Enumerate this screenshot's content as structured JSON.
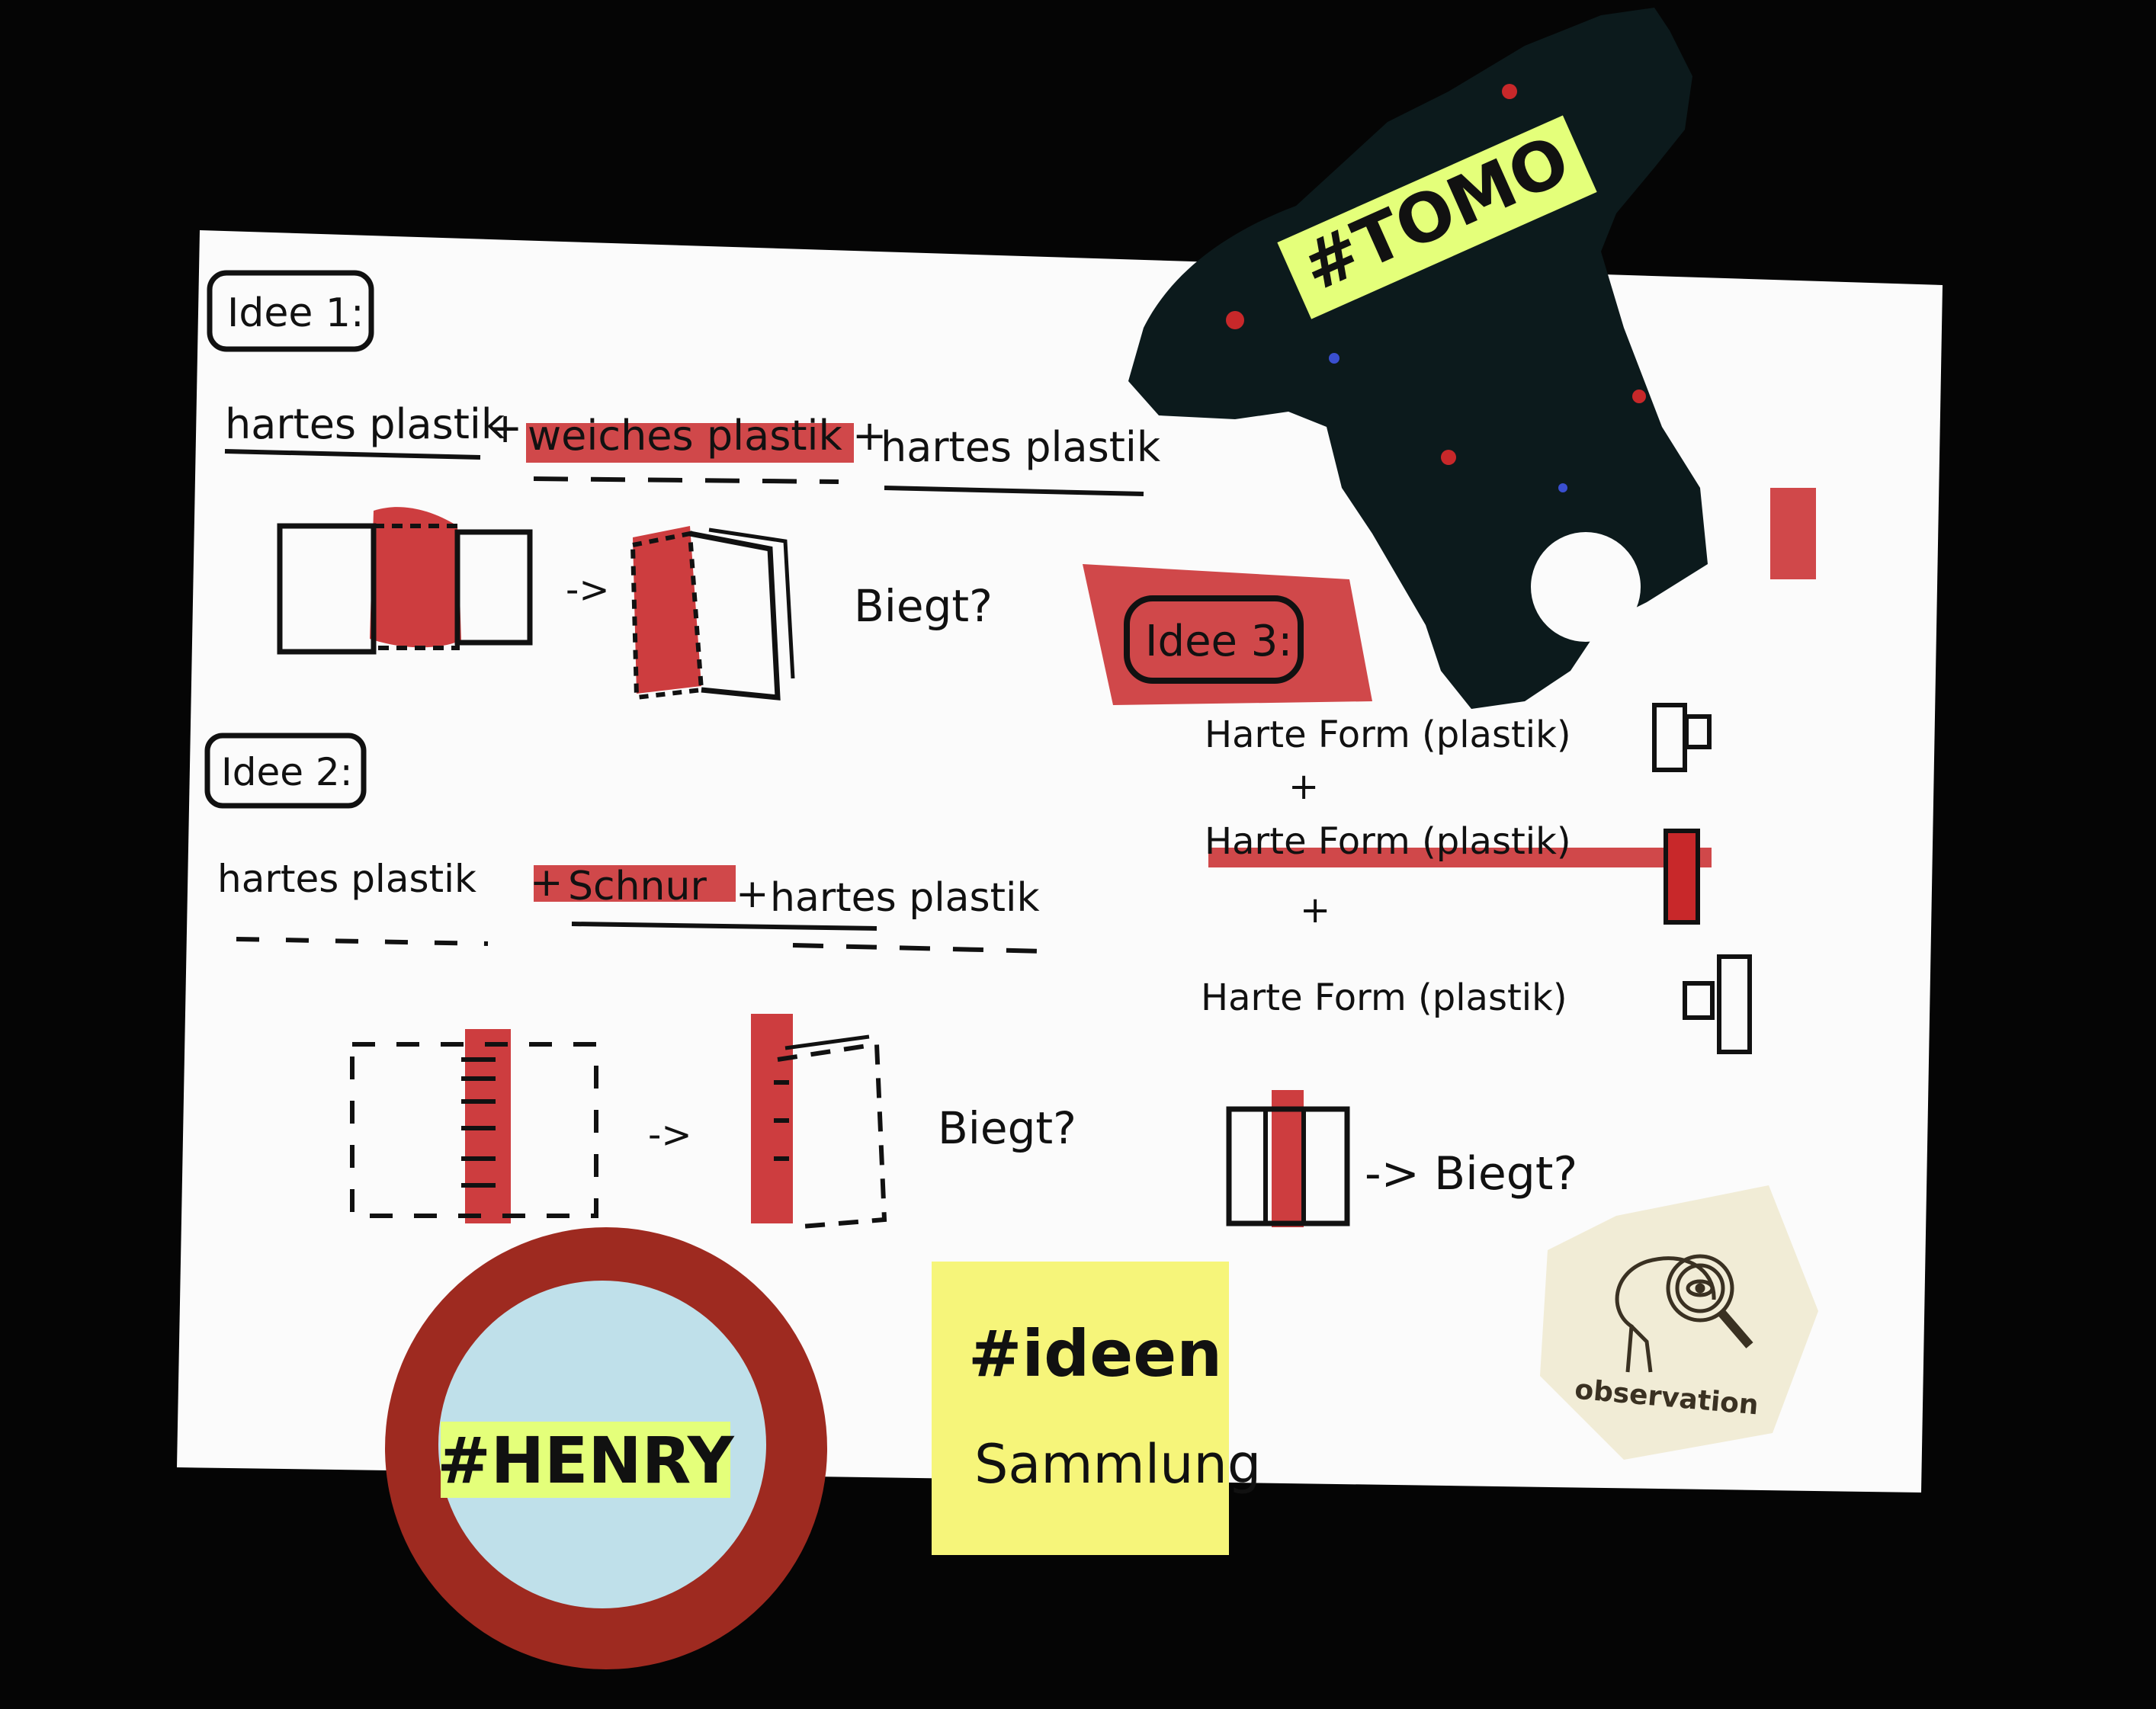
{
  "sheet": {
    "idee1": {
      "heading": "Idee 1:",
      "formula_part1": "hartes plastik",
      "plus1": "+",
      "formula_part2": "weiches plastik",
      "plus2": "+",
      "formula_part3": "hartes plastik",
      "arrow": "->",
      "question": "Biegt?"
    },
    "idee2": {
      "heading": "Idee 2:",
      "formula_part1": "hartes plastik",
      "plus1": "+",
      "formula_part2": "Schnur",
      "plus2": "+",
      "formula_part3": "hartes plastik",
      "arrow": "->",
      "question": "Biegt?"
    },
    "idee3": {
      "heading": "Idee 3:",
      "line1": "Harte Form (plastik)",
      "plus1": "+",
      "line2": "Harte Form (plastik)",
      "plus2": "+",
      "line3": "Harte Form (plastik)",
      "result": "-> Biegt?"
    }
  },
  "tags": {
    "tomo": "#TOMO",
    "henry": "#HENRY"
  },
  "sticky_note": {
    "line1": "#ideen",
    "line2": "Sammlung"
  },
  "hex_badge": {
    "label": "observation",
    "icon": "head-magnifier-eye-icon"
  },
  "colors": {
    "background": "#050505",
    "paper": "#fbfbfb",
    "marker_red": "#c8282a",
    "ink": "#111111",
    "tag_yellow": "#e4ff7a",
    "sticky_yellow": "#f6f57a",
    "ring_red": "#9e2a20",
    "ring_inner": "#bfe0ea",
    "tomo_piece": "#0c1a1c",
    "hex_fill": "#f1ecd6"
  }
}
